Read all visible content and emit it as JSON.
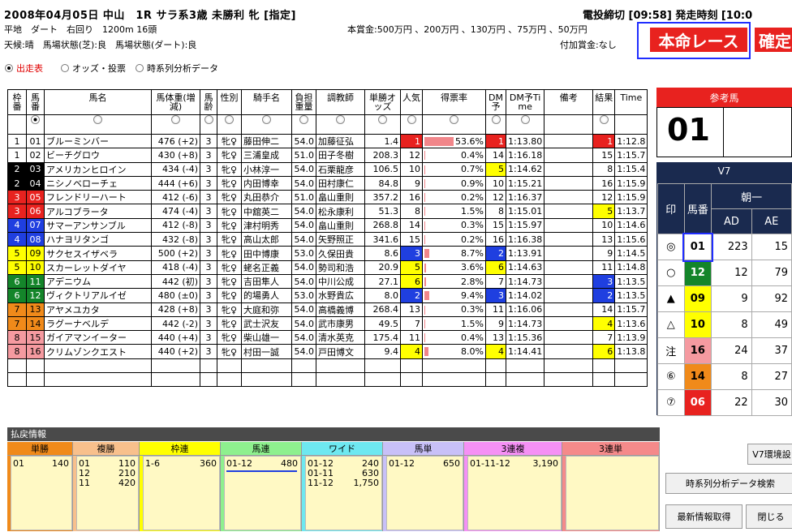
{
  "header": {
    "title": "2008年04月05日 中山　1R サラ系3歳 未勝利 牝 [指定]",
    "course": "平地　ダート　右回り　1200m 16頭",
    "weather": "天候:晴　馬場状態(芝):良　馬場状態(ダート):良",
    "prize": "本賞金:500万円 、200万円 、130万円 、75万円 、50万円",
    "extra_prize": "付加賞金:なし",
    "deadline": "電投締切 [09:58] 発走時刻 [10:0",
    "honmei_label": "本命レース",
    "kakutei_label": "確定"
  },
  "tabs": [
    {
      "label": "出走表",
      "active": true
    },
    {
      "label": "オッズ・投票",
      "active": false
    },
    {
      "label": "時系列分析データ",
      "active": false
    }
  ],
  "table": {
    "columns": [
      "枠番",
      "馬番",
      "馬名",
      "馬体重(増減)",
      "馬齢",
      "性別",
      "騎手名",
      "負担重量",
      "調教師",
      "単勝オッズ",
      "人気",
      "得票率",
      "DM予",
      "DM予Time",
      "備考",
      "結果",
      "Time"
    ],
    "rows": [
      {
        "waku": "1",
        "num": "01",
        "name": "ブルーミンバー",
        "weight": "476 (+2)",
        "age": "3",
        "sex": "牝♀",
        "jockey": "藤田伸二",
        "load": "54.0",
        "trainer": "加藤征弘",
        "odds": "1.4",
        "pop": "1",
        "pop_color": "red",
        "rate": "53.6%",
        "rate_val": 53.6,
        "dm": "1",
        "dm_color": "red",
        "dm_time": "1:13.80",
        "note": "",
        "result": "1",
        "result_color": "red",
        "time": "1:12.8"
      },
      {
        "waku": "1",
        "num": "02",
        "name": "ビーチグロウ",
        "weight": "430 (+8)",
        "age": "3",
        "sex": "牝♀",
        "jockey": "三浦皇成",
        "load": "51.0",
        "trainer": "田子冬樹",
        "odds": "208.3",
        "pop": "12",
        "pop_color": "",
        "rate": "0.4%",
        "rate_val": 0.4,
        "dm": "14",
        "dm_color": "",
        "dm_time": "1:16.18",
        "note": "",
        "result": "15",
        "result_color": "",
        "time": "1:15.7"
      },
      {
        "waku": "2",
        "num": "03",
        "name": "アメリカンヒロイン",
        "weight": "434 (-4)",
        "age": "3",
        "sex": "牝♀",
        "jockey": "小林淳一",
        "load": "54.0",
        "trainer": "石栗龍彦",
        "odds": "106.5",
        "pop": "10",
        "pop_color": "",
        "rate": "0.7%",
        "rate_val": 0.7,
        "dm": "5",
        "dm_color": "yellow",
        "dm_time": "1:14.62",
        "note": "",
        "result": "8",
        "result_color": "",
        "time": "1:15.4"
      },
      {
        "waku": "2",
        "num": "04",
        "name": "ニシノベローチェ",
        "weight": "444 (+6)",
        "age": "3",
        "sex": "牝♀",
        "jockey": "内田博幸",
        "load": "54.0",
        "trainer": "田村康仁",
        "odds": "84.8",
        "pop": "9",
        "pop_color": "",
        "rate": "0.9%",
        "rate_val": 0.9,
        "dm": "10",
        "dm_color": "",
        "dm_time": "1:15.21",
        "note": "",
        "result": "16",
        "result_color": "",
        "time": "1:15.9"
      },
      {
        "waku": "3",
        "num": "05",
        "name": "フレンドリーハート",
        "weight": "412 (-6)",
        "age": "3",
        "sex": "牝♀",
        "jockey": "丸田恭介",
        "load": "51.0",
        "trainer": "畠山重則",
        "odds": "357.2",
        "pop": "16",
        "pop_color": "",
        "rate": "0.2%",
        "rate_val": 0.2,
        "dm": "12",
        "dm_color": "",
        "dm_time": "1:16.37",
        "note": "",
        "result": "12",
        "result_color": "",
        "time": "1:15.9"
      },
      {
        "waku": "3",
        "num": "06",
        "name": "アルコブラータ",
        "weight": "474 (-4)",
        "age": "3",
        "sex": "牝♀",
        "jockey": "中舘英二",
        "load": "54.0",
        "trainer": "松永康利",
        "odds": "51.3",
        "pop": "8",
        "pop_color": "",
        "rate": "1.5%",
        "rate_val": 1.5,
        "dm": "8",
        "dm_color": "",
        "dm_time": "1:15.01",
        "note": "",
        "result": "5",
        "result_color": "yellow",
        "time": "1:13.7"
      },
      {
        "waku": "4",
        "num": "07",
        "name": "サマーアンサンブル",
        "weight": "412 (-8)",
        "age": "3",
        "sex": "牝♀",
        "jockey": "津村明秀",
        "load": "54.0",
        "trainer": "畠山重則",
        "odds": "268.8",
        "pop": "14",
        "pop_color": "",
        "rate": "0.3%",
        "rate_val": 0.3,
        "dm": "15",
        "dm_color": "",
        "dm_time": "1:15.97",
        "note": "",
        "result": "10",
        "result_color": "",
        "time": "1:14.6"
      },
      {
        "waku": "4",
        "num": "08",
        "name": "ハナヨリタンゴ",
        "weight": "432 (-8)",
        "age": "3",
        "sex": "牝♀",
        "jockey": "高山太郎",
        "load": "54.0",
        "trainer": "矢野照正",
        "odds": "341.6",
        "pop": "15",
        "pop_color": "",
        "rate": "0.2%",
        "rate_val": 0.2,
        "dm": "16",
        "dm_color": "",
        "dm_time": "1:16.38",
        "note": "",
        "result": "13",
        "result_color": "",
        "time": "1:15.6"
      },
      {
        "waku": "5",
        "num": "09",
        "name": "サクセスイザベラ",
        "weight": "500 (+2)",
        "age": "3",
        "sex": "牝♀",
        "jockey": "田中博康",
        "load": "53.0",
        "trainer": "久保田貴",
        "odds": "8.6",
        "pop": "3",
        "pop_color": "blue",
        "rate": "8.7%",
        "rate_val": 8.7,
        "dm": "2",
        "dm_color": "blue",
        "dm_time": "1:13.91",
        "note": "",
        "result": "9",
        "result_color": "",
        "time": "1:14.5"
      },
      {
        "waku": "5",
        "num": "10",
        "name": "スカーレットダイヤ",
        "weight": "418 (-4)",
        "age": "3",
        "sex": "牝♀",
        "jockey": "蛯名正義",
        "load": "54.0",
        "trainer": "勢司和浩",
        "odds": "20.9",
        "pop": "5",
        "pop_color": "yellow",
        "rate": "3.6%",
        "rate_val": 3.6,
        "dm": "6",
        "dm_color": "yellow",
        "dm_time": "1:14.63",
        "note": "",
        "result": "11",
        "result_color": "",
        "time": "1:14.8"
      },
      {
        "waku": "6",
        "num": "11",
        "name": "アデニウム",
        "weight": "442 (初)",
        "age": "3",
        "sex": "牝♀",
        "jockey": "吉田隼人",
        "load": "54.0",
        "trainer": "中川公成",
        "odds": "27.1",
        "pop": "6",
        "pop_color": "yellow",
        "rate": "2.8%",
        "rate_val": 2.8,
        "dm": "7",
        "dm_color": "",
        "dm_time": "1:14.73",
        "note": "",
        "result": "3",
        "result_color": "blue",
        "time": "1:13.5"
      },
      {
        "waku": "6",
        "num": "12",
        "name": "ヴィクトリアルイゼ",
        "weight": "480 (±0)",
        "age": "3",
        "sex": "牝♀",
        "jockey": "的場勇人",
        "load": "53.0",
        "trainer": "水野貴広",
        "odds": "8.0",
        "pop": "2",
        "pop_color": "blue",
        "rate": "9.4%",
        "rate_val": 9.4,
        "dm": "3",
        "dm_color": "blue",
        "dm_time": "1:14.02",
        "note": "",
        "result": "2",
        "result_color": "blue",
        "time": "1:13.5"
      },
      {
        "waku": "7",
        "num": "13",
        "name": "アヤメユカタ",
        "weight": "428 (+8)",
        "age": "3",
        "sex": "牝♀",
        "jockey": "大庭和弥",
        "load": "54.0",
        "trainer": "高橋義博",
        "odds": "268.4",
        "pop": "13",
        "pop_color": "",
        "rate": "0.3%",
        "rate_val": 0.3,
        "dm": "11",
        "dm_color": "",
        "dm_time": "1:16.06",
        "note": "",
        "result": "14",
        "result_color": "",
        "time": "1:15.7"
      },
      {
        "waku": "7",
        "num": "14",
        "name": "ラグーナベルデ",
        "weight": "442 (-2)",
        "age": "3",
        "sex": "牝♀",
        "jockey": "武士沢友",
        "load": "54.0",
        "trainer": "武市康男",
        "odds": "49.5",
        "pop": "7",
        "pop_color": "",
        "rate": "1.5%",
        "rate_val": 1.5,
        "dm": "9",
        "dm_color": "",
        "dm_time": "1:14.73",
        "note": "",
        "result": "4",
        "result_color": "yellow",
        "time": "1:13.6"
      },
      {
        "waku": "8",
        "num": "15",
        "name": "ガイアマンイーター",
        "weight": "440 (+4)",
        "age": "3",
        "sex": "牝♀",
        "jockey": "柴山雄一",
        "load": "54.0",
        "trainer": "清水英克",
        "odds": "175.4",
        "pop": "11",
        "pop_color": "",
        "rate": "0.4%",
        "rate_val": 0.4,
        "dm": "13",
        "dm_color": "",
        "dm_time": "1:15.36",
        "note": "",
        "result": "7",
        "result_color": "",
        "time": "1:13.9"
      },
      {
        "waku": "8",
        "num": "16",
        "name": "クリムゾンクエスト",
        "weight": "440 (+2)",
        "age": "3",
        "sex": "牝♀",
        "jockey": "村田一誠",
        "load": "54.0",
        "trainer": "戸田博文",
        "odds": "9.4",
        "pop": "4",
        "pop_color": "yellow",
        "rate": "8.0%",
        "rate_val": 8.0,
        "dm": "4",
        "dm_color": "yellow",
        "dm_time": "1:14.41",
        "note": "",
        "result": "6",
        "result_color": "yellow",
        "time": "1:13.8"
      }
    ]
  },
  "reference": {
    "title": "参考馬",
    "num": "01"
  },
  "v7": {
    "title": "V7",
    "expert": "朝一",
    "col_mark": "印",
    "col_num": "馬番",
    "col_ad": "AD",
    "col_ae": "AE",
    "rows": [
      {
        "mark": "◎",
        "num": "01",
        "waku": "1",
        "ad": "223",
        "ae": "15"
      },
      {
        "mark": "○",
        "num": "12",
        "waku": "6",
        "ad": "12",
        "ae": "79"
      },
      {
        "mark": "▲",
        "num": "09",
        "waku": "5",
        "ad": "9",
        "ae": "92"
      },
      {
        "mark": "△",
        "num": "10",
        "waku": "5",
        "ad": "8",
        "ae": "49"
      },
      {
        "mark": "注",
        "num": "16",
        "waku": "8",
        "ad": "24",
        "ae": "37"
      },
      {
        "mark": "⑥",
        "num": "14",
        "waku": "7",
        "ad": "8",
        "ae": "27"
      },
      {
        "mark": "⑦",
        "num": "06",
        "waku": "3",
        "ad": "22",
        "ae": "30"
      }
    ]
  },
  "payout": {
    "title": "払戻情報",
    "groups": [
      {
        "label": "単勝",
        "head_color": "#f08a1a",
        "side_color": "#f08a1a",
        "lines": [
          {
            "k": "01",
            "v": "140"
          }
        ]
      },
      {
        "label": "複勝",
        "head_color": "#f8c08c",
        "side_color": "#f8c08c",
        "lines": [
          {
            "k": "01",
            "v": "110"
          },
          {
            "k": "12",
            "v": "210"
          },
          {
            "k": "11",
            "v": "420"
          }
        ]
      },
      {
        "label": "枠連",
        "head_color": "#ffff00",
        "side_color": "#ffff00",
        "lines": [
          {
            "k": "1-6",
            "v": "360"
          }
        ]
      },
      {
        "label": "馬連",
        "head_color": "#8ef08e",
        "side_color": "#8ef08e",
        "lines": [
          {
            "k": "01-12",
            "v": "480"
          }
        ]
      },
      {
        "label": "ワイド",
        "head_color": "#6ee8f0",
        "side_color": "#6ee8f0",
        "lines": [
          {
            "k": "01-12",
            "v": "240"
          },
          {
            "k": "01-11",
            "v": "630"
          },
          {
            "k": "11-12",
            "v": "1,750"
          }
        ]
      },
      {
        "label": "馬単",
        "head_color": "#c8c0f8",
        "side_color": "#c8c0f8",
        "lines": [
          {
            "k": "01-12",
            "v": "650"
          }
        ]
      },
      {
        "label": "3連複",
        "head_color": "#f590f5",
        "side_color": "#f590f5",
        "lines": [
          {
            "k": "01-11-12",
            "v": "3,190"
          }
        ]
      },
      {
        "label": "3連単",
        "head_color": "#f58a8a",
        "side_color": "#f58a8a",
        "lines": []
      }
    ]
  },
  "buttons": {
    "v7_env": "V7環境設",
    "series_search": "時系列分析データ検索",
    "latest": "最新情報取得",
    "close": "閉じる"
  }
}
